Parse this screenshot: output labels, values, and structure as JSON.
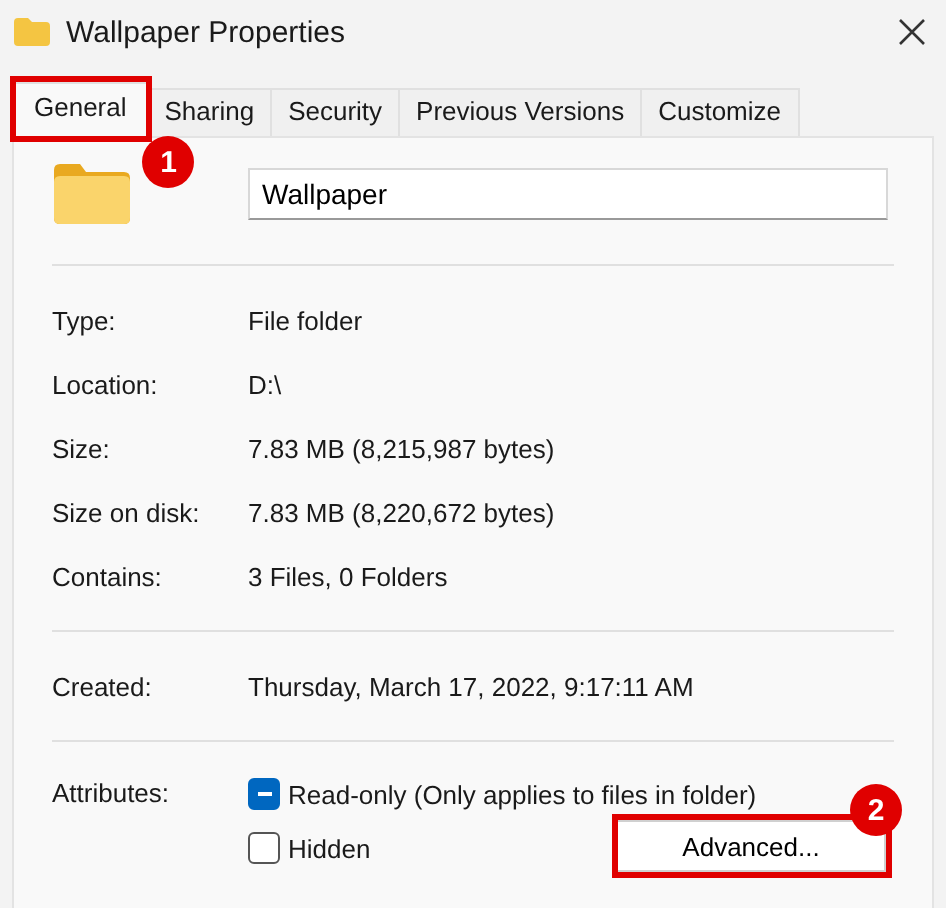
{
  "window": {
    "title": "Wallpaper Properties"
  },
  "tabs": [
    {
      "label": "General",
      "selected": true,
      "callout": "1"
    },
    {
      "label": "Sharing",
      "selected": false
    },
    {
      "label": "Security",
      "selected": false
    },
    {
      "label": "Previous Versions",
      "selected": false
    },
    {
      "label": "Customize",
      "selected": false
    }
  ],
  "name_field": {
    "value": "Wallpaper"
  },
  "groups": [
    [
      {
        "label": "Type:",
        "value": "File folder"
      },
      {
        "label": "Location:",
        "value": "D:\\"
      },
      {
        "label": "Size:",
        "value": "7.83 MB (8,215,987 bytes)"
      },
      {
        "label": "Size on disk:",
        "value": "7.83 MB (8,220,672 bytes)"
      },
      {
        "label": "Contains:",
        "value": "3 Files, 0 Folders"
      }
    ],
    [
      {
        "label": "Created:",
        "value": "Thursday, March 17, 2022, 9:17:11 AM"
      }
    ]
  ],
  "attributes": {
    "label": "Attributes:",
    "options": [
      {
        "label": "Read-only (Only applies to files in folder)",
        "checked": true,
        "indeterminate": true
      },
      {
        "label": "Hidden",
        "checked": false,
        "indeterminate": false
      }
    ],
    "button": {
      "label": "Advanced...",
      "callout": "2"
    }
  }
}
